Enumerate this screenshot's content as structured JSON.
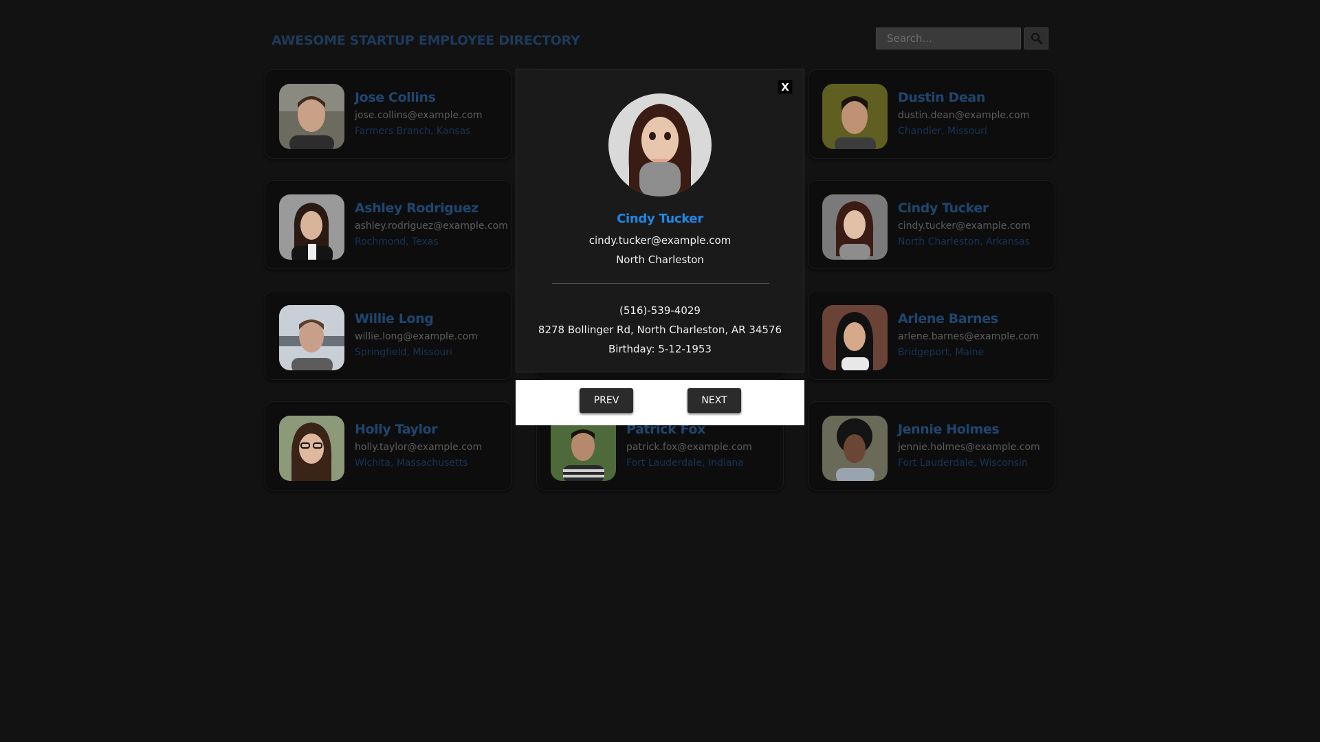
{
  "header": {
    "title": "AWESOME STARTUP EMPLOYEE DIRECTORY",
    "search_placeholder": "Search...",
    "search_button_icon": "search-icon"
  },
  "employees": [
    {
      "name": "Jose Collins",
      "email": "jose.collins@example.com",
      "location": "Farmers Branch, Kansas"
    },
    {
      "name": "Dustin Dean",
      "email": "dustin.dean@example.com",
      "location": "Chandler, Missouri"
    },
    {
      "name": "Ashley Rodriguez",
      "email": "ashley.rodriguez@example.com",
      "location": "Rochmond, Texas"
    },
    {
      "name": "Cindy Tucker",
      "email": "cindy.tucker@example.com",
      "location": "North Charleston, Arkansas"
    },
    {
      "name": "Willie Long",
      "email": "willie.long@example.com",
      "location": "Springfield, Missouri"
    },
    {
      "name": "Arlene Barnes",
      "email": "arlene.barnes@example.com",
      "location": "Bridgeport, Maine"
    },
    {
      "name": "Holly Taylor",
      "email": "holly.taylor@example.com",
      "location": "Wichita, Massachusetts"
    },
    {
      "name": "Patrick Fox",
      "email": "patrick.fox@example.com",
      "location": "Fort Lauderdale, Indiana"
    },
    {
      "name": "Jennie Holmes",
      "email": "jennie.holmes@example.com",
      "location": "Fort Lauderdale, Wisconsin"
    }
  ],
  "modal": {
    "close_label": "X",
    "name": "Cindy Tucker",
    "email": "cindy.tucker@example.com",
    "city": "North Charleston",
    "phone": "(516)-539-4029",
    "address": "8278 Bollinger Rd, North Charleston, AR 34576",
    "birthday": "Birthday: 5-12-1953",
    "prev_label": "PREV",
    "next_label": "NEXT"
  },
  "colors": {
    "background": "#121212",
    "accent": "#1e88e5",
    "card_name": "#1f4670",
    "modal_bg": "#1a1a1a"
  }
}
